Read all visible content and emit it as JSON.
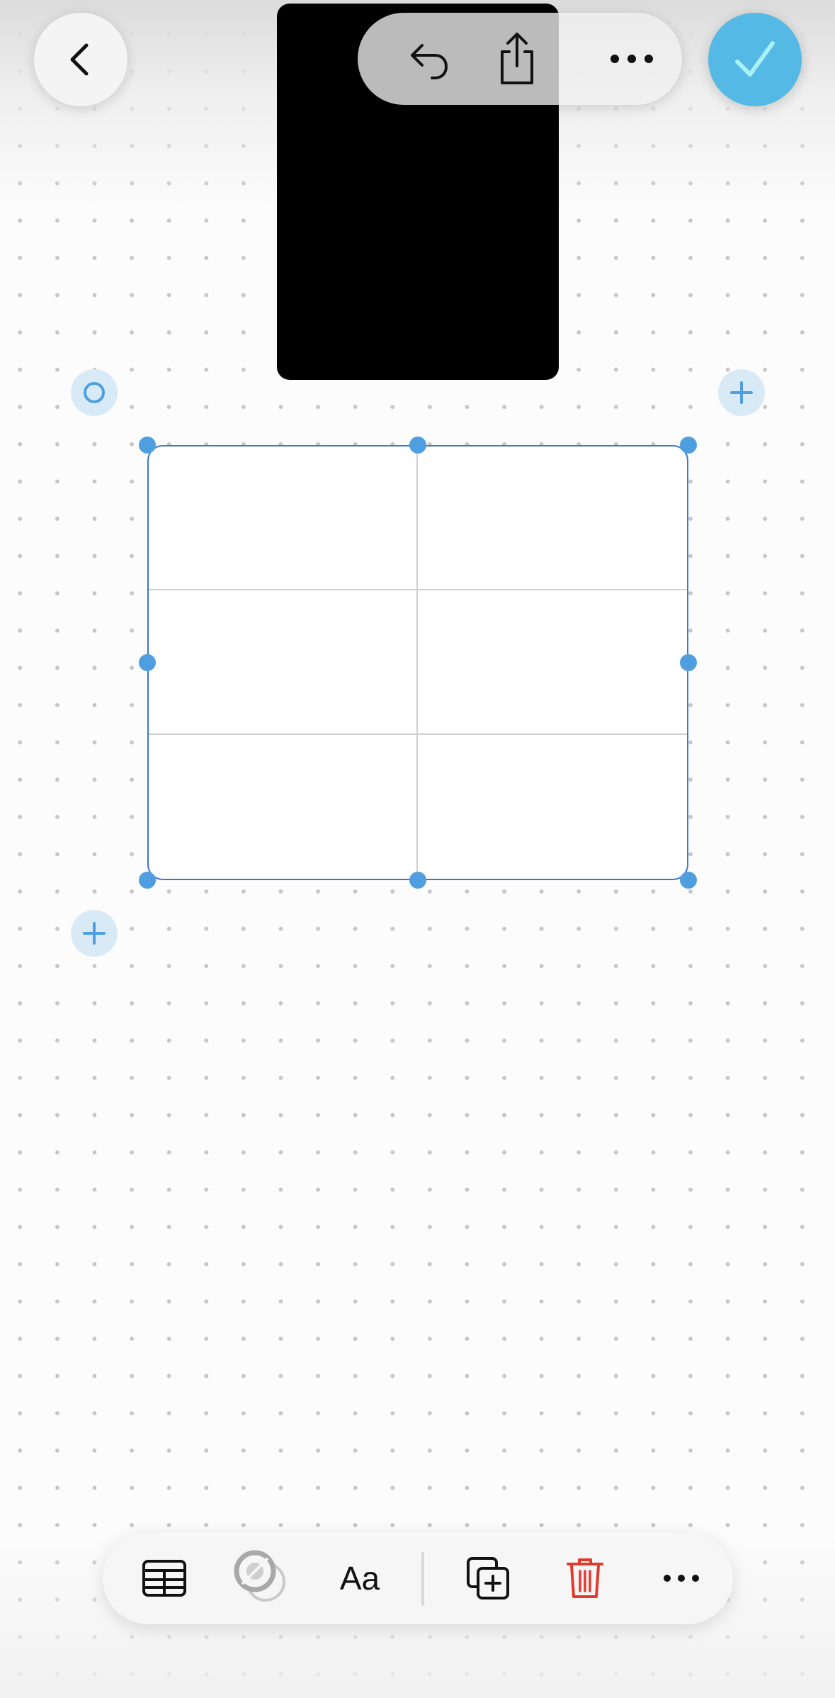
{
  "top_bar": {
    "back_icon": "chevron-left-icon",
    "undo_icon": "undo-arrow-icon",
    "share_icon": "share-icon",
    "more_icon": "ellipsis-icon",
    "done_icon": "checkmark-icon",
    "done_color": "#55b9e6"
  },
  "canvas": {
    "background": "dot-grid",
    "table": {
      "columns": 2,
      "rows": 3,
      "cells": [
        [
          "",
          ""
        ],
        [
          "",
          ""
        ],
        [
          "",
          ""
        ]
      ],
      "selected": true,
      "selection_color": "#3f73d4"
    },
    "table_move_icon": "circle-handle-icon",
    "add_column_icon": "plus-icon",
    "add_row_icon": "plus-icon"
  },
  "bottom_toolbar": {
    "table_icon": "table-icon",
    "style_icon": "fill-stroke-icon",
    "text_format_label": "Aa",
    "duplicate_icon": "duplicate-icon",
    "delete_icon": "trash-icon",
    "delete_color": "#e03a2f",
    "more_icon": "ellipsis-icon"
  }
}
